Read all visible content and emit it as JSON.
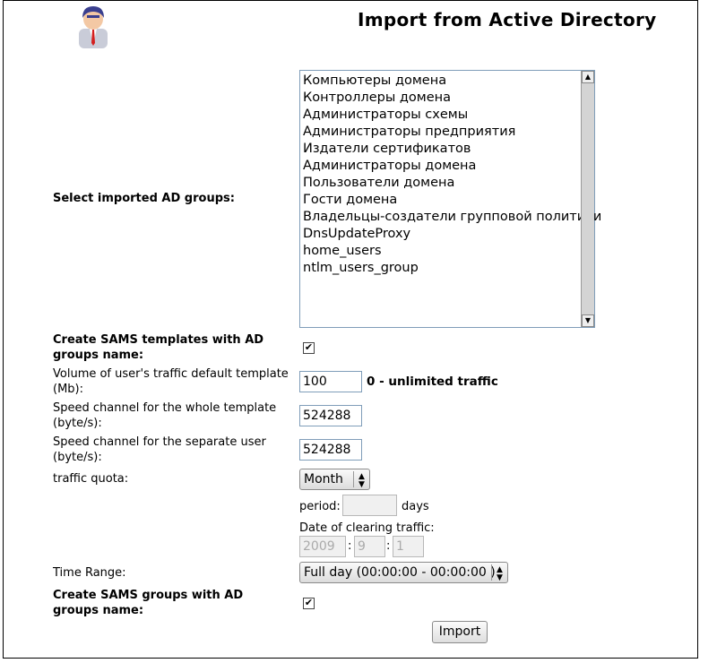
{
  "header": {
    "title": "Import from Active Directory"
  },
  "form": {
    "groups_label": "Select imported AD groups:",
    "groups": [
      "Компьютеры домена",
      "Контроллеры домена",
      "Администраторы схемы",
      "Администраторы предприятия",
      "Издатели сертификатов",
      "Администраторы домена",
      "Пользователи домена",
      "Гости домена",
      "Владельцы-создатели групповой политики",
      "DnsUpdateProxy",
      "home_users",
      "ntlm_users_group"
    ],
    "create_templates_label": "Create SAMS templates with AD groups name:",
    "volume_label": "Volume of user's traffic default template (Mb):",
    "volume_value": "100",
    "volume_hint": "0 - unlimited traffic",
    "speed_template_label": "Speed channel for the whole template (byte/s):",
    "speed_template_value": "524288",
    "speed_user_label": "Speed channel for the separate user (byte/s):",
    "speed_user_value": "524288",
    "quota_label": "traffic quota:",
    "quota_value": "Month",
    "period_label": "period:",
    "period_value": "",
    "days_label": "days",
    "clear_date_label": "Date of clearing traffic:",
    "clear_year": "2009",
    "clear_month": "9",
    "clear_day": "1",
    "time_range_label": "Time Range:",
    "time_range_value": "Full day (00:00:00 - 00:00:00 )",
    "create_groups_label": "Create SAMS groups with AD groups name:",
    "import_button": "Import",
    "create_templates_checked": true,
    "create_groups_checked": true
  },
  "icons": {
    "user_avatar": "user-avatar-icon",
    "checkmark": "✔"
  }
}
